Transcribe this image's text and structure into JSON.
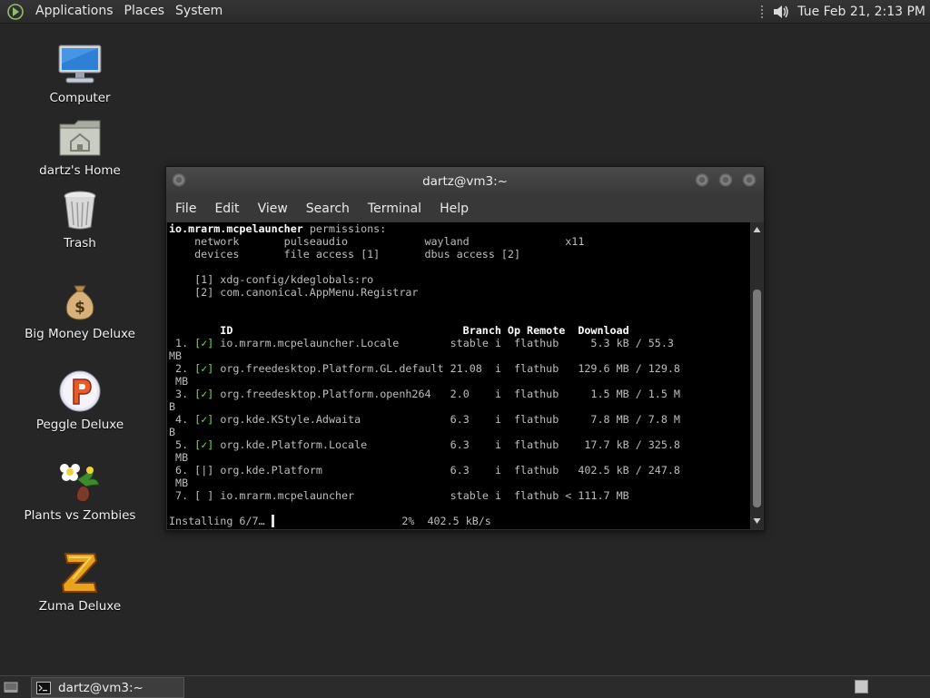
{
  "top_panel": {
    "menus": [
      "Applications",
      "Places",
      "System"
    ],
    "clock": "Tue Feb 21,  2:13 PM"
  },
  "desktop_icons": [
    {
      "label": "Computer",
      "icon": "computer-icon"
    },
    {
      "label": "dartz's Home",
      "icon": "home-folder-icon"
    },
    {
      "label": "Trash",
      "icon": "trash-icon"
    },
    {
      "label": "Big Money Deluxe",
      "icon": "money-bag-icon"
    },
    {
      "label": "Peggle Deluxe",
      "icon": "peggle-icon"
    },
    {
      "label": "Plants vs Zombies",
      "icon": "plants-vs-zombies-icon"
    },
    {
      "label": "Zuma Deluxe",
      "icon": "zuma-icon"
    }
  ],
  "terminal": {
    "title": "dartz@vm3:~",
    "menus": [
      "File",
      "Edit",
      "View",
      "Search",
      "Terminal",
      "Help"
    ],
    "app_id": "io.mrarm.mcpelauncher",
    "permissions_label": " permissions:",
    "perm_line_1": "    network       pulseaudio            wayland               x11",
    "perm_line_2": "    devices       file access [1]       dbus access [2]",
    "ref_1": "    [1] xdg-config/kdeglobals:ro",
    "ref_2": "    [2] com.canonical.AppMenu.Registrar",
    "table_header": "        ID                                    Branch Op Remote  Download",
    "rows": [
      {
        "num": " 1. ",
        "mark": "[✓]",
        "rest": " io.mrarm.mcpelauncher.Locale        stable i  flathub     5.3 kB / 55.3",
        "wrap": "MB"
      },
      {
        "num": " 2. ",
        "mark": "[✓]",
        "rest": " org.freedesktop.Platform.GL.default 21.08  i  flathub   129.6 MB / 129.8",
        "wrap": " MB"
      },
      {
        "num": " 3. ",
        "mark": "[✓]",
        "rest": " org.freedesktop.Platform.openh264   2.0    i  flathub     1.5 MB / 1.5 M",
        "wrap": "B"
      },
      {
        "num": " 4. ",
        "mark": "[✓]",
        "rest": " org.kde.KStyle.Adwaita              6.3    i  flathub     7.8 MB / 7.8 M",
        "wrap": "B"
      },
      {
        "num": " 5. ",
        "mark": "[✓]",
        "rest": " org.kde.Platform.Locale             6.3    i  flathub    17.7 kB / 325.8",
        "wrap": " MB"
      },
      {
        "num": " 6. ",
        "mark": "[|]",
        "rest": " org.kde.Platform                    6.3    i  flathub   402.5 kB / 247.8",
        "wrap": " MB"
      },
      {
        "num": " 7. ",
        "mark": "[ ]",
        "rest": " io.mrarm.mcpelauncher               stable i  flathub < 111.7 MB",
        "wrap": null
      }
    ],
    "status_left": "Installing 6/7… ",
    "status_right": "                    2%  402.5 kB/s"
  },
  "taskbar": {
    "task_label": "dartz@vm3:~"
  }
}
